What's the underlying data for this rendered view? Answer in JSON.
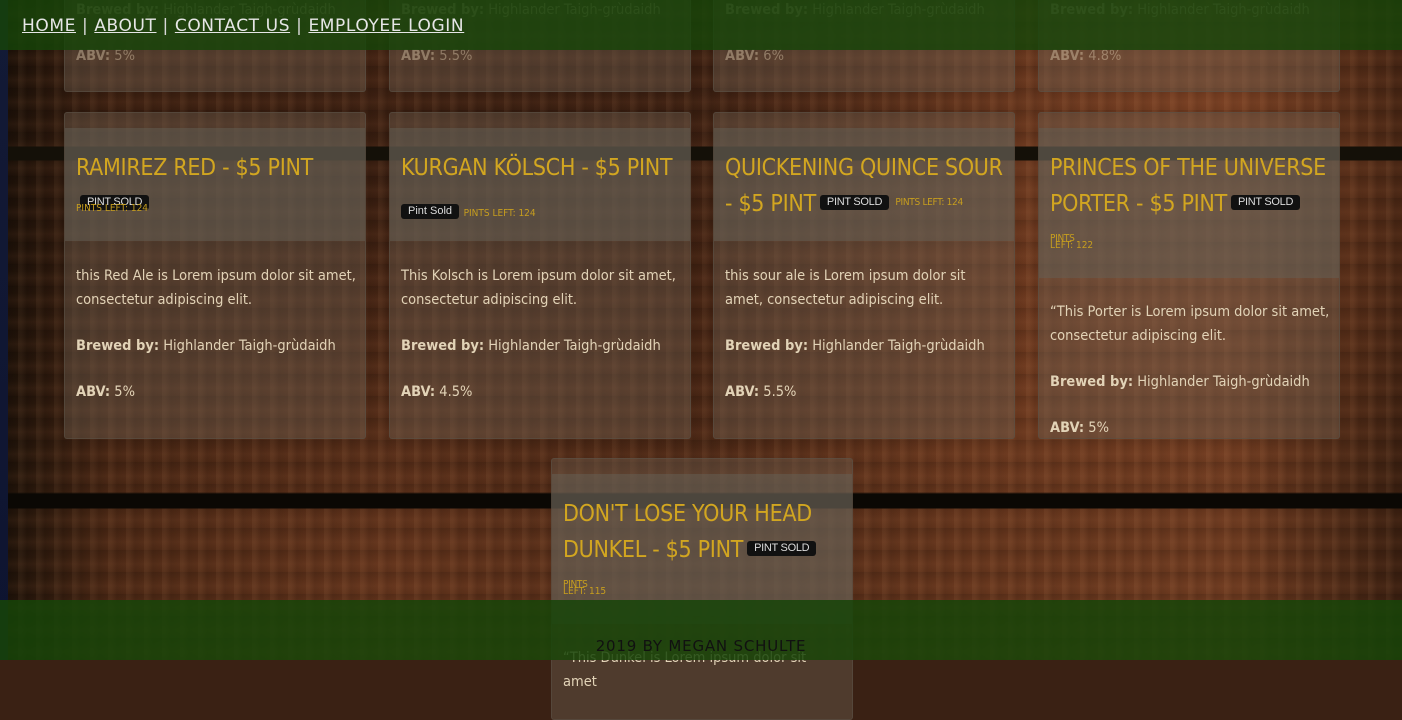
{
  "nav": {
    "links": [
      "HOME",
      "ABOUT",
      "CONTACT US",
      "EMPLOYEE LOGIN"
    ],
    "separator": "|"
  },
  "badge_label": "Pint Sold",
  "labels": {
    "brewed_by": "Brewed by:",
    "abv": "ABV:"
  },
  "brewer": "Highlander Taigh-grùdaidh",
  "top_row_ghost": [
    {
      "abv": "5%"
    },
    {
      "abv": "5.5%"
    },
    {
      "abv": "6%"
    },
    {
      "abv": "4.8%"
    }
  ],
  "beers": [
    {
      "title": "RAMIREZ RED - $5 PINT",
      "pints_left": "PINTS LEFT: 124",
      "description": "this Red Ale is Lorem ipsum dolor sit amet, consectetur adipiscing elit.",
      "abv": "5%"
    },
    {
      "title": "KURGAN KÖLSCH - $5 PINT",
      "pints_left": "PINTS LEFT: 124",
      "description": "This Kolsch is Lorem ipsum dolor sit amet, consectetur adipiscing elit.",
      "abv": "4.5%"
    },
    {
      "title": "QUICKENING QUINCE SOUR - $5 PINT",
      "pints_left": "PINTS LEFT: 124",
      "description": "this sour ale is Lorem ipsum dolor sit amet, consectetur adipiscing elit.",
      "abv": "5.5%"
    },
    {
      "title": "PRINCES OF THE UNIVERSE PORTER - $5 PINT",
      "pints_left_a": "PINTS",
      "pints_left_b": "LEFT: 122",
      "description": "“This Porter is Lorem ipsum dolor sit amet, consectetur adipiscing elit.",
      "abv": "5%"
    },
    {
      "title": "DON'T LOSE YOUR HEAD DUNKEL - $5 PINT",
      "pints_left_a": "PINTS",
      "pints_left_b": "LEFT: 115",
      "description_partial": "“This Dunkel is Lorem ipsum dolor sit amet"
    }
  ],
  "footer": {
    "text": "2019 BY MEGAN SCHULTE"
  }
}
